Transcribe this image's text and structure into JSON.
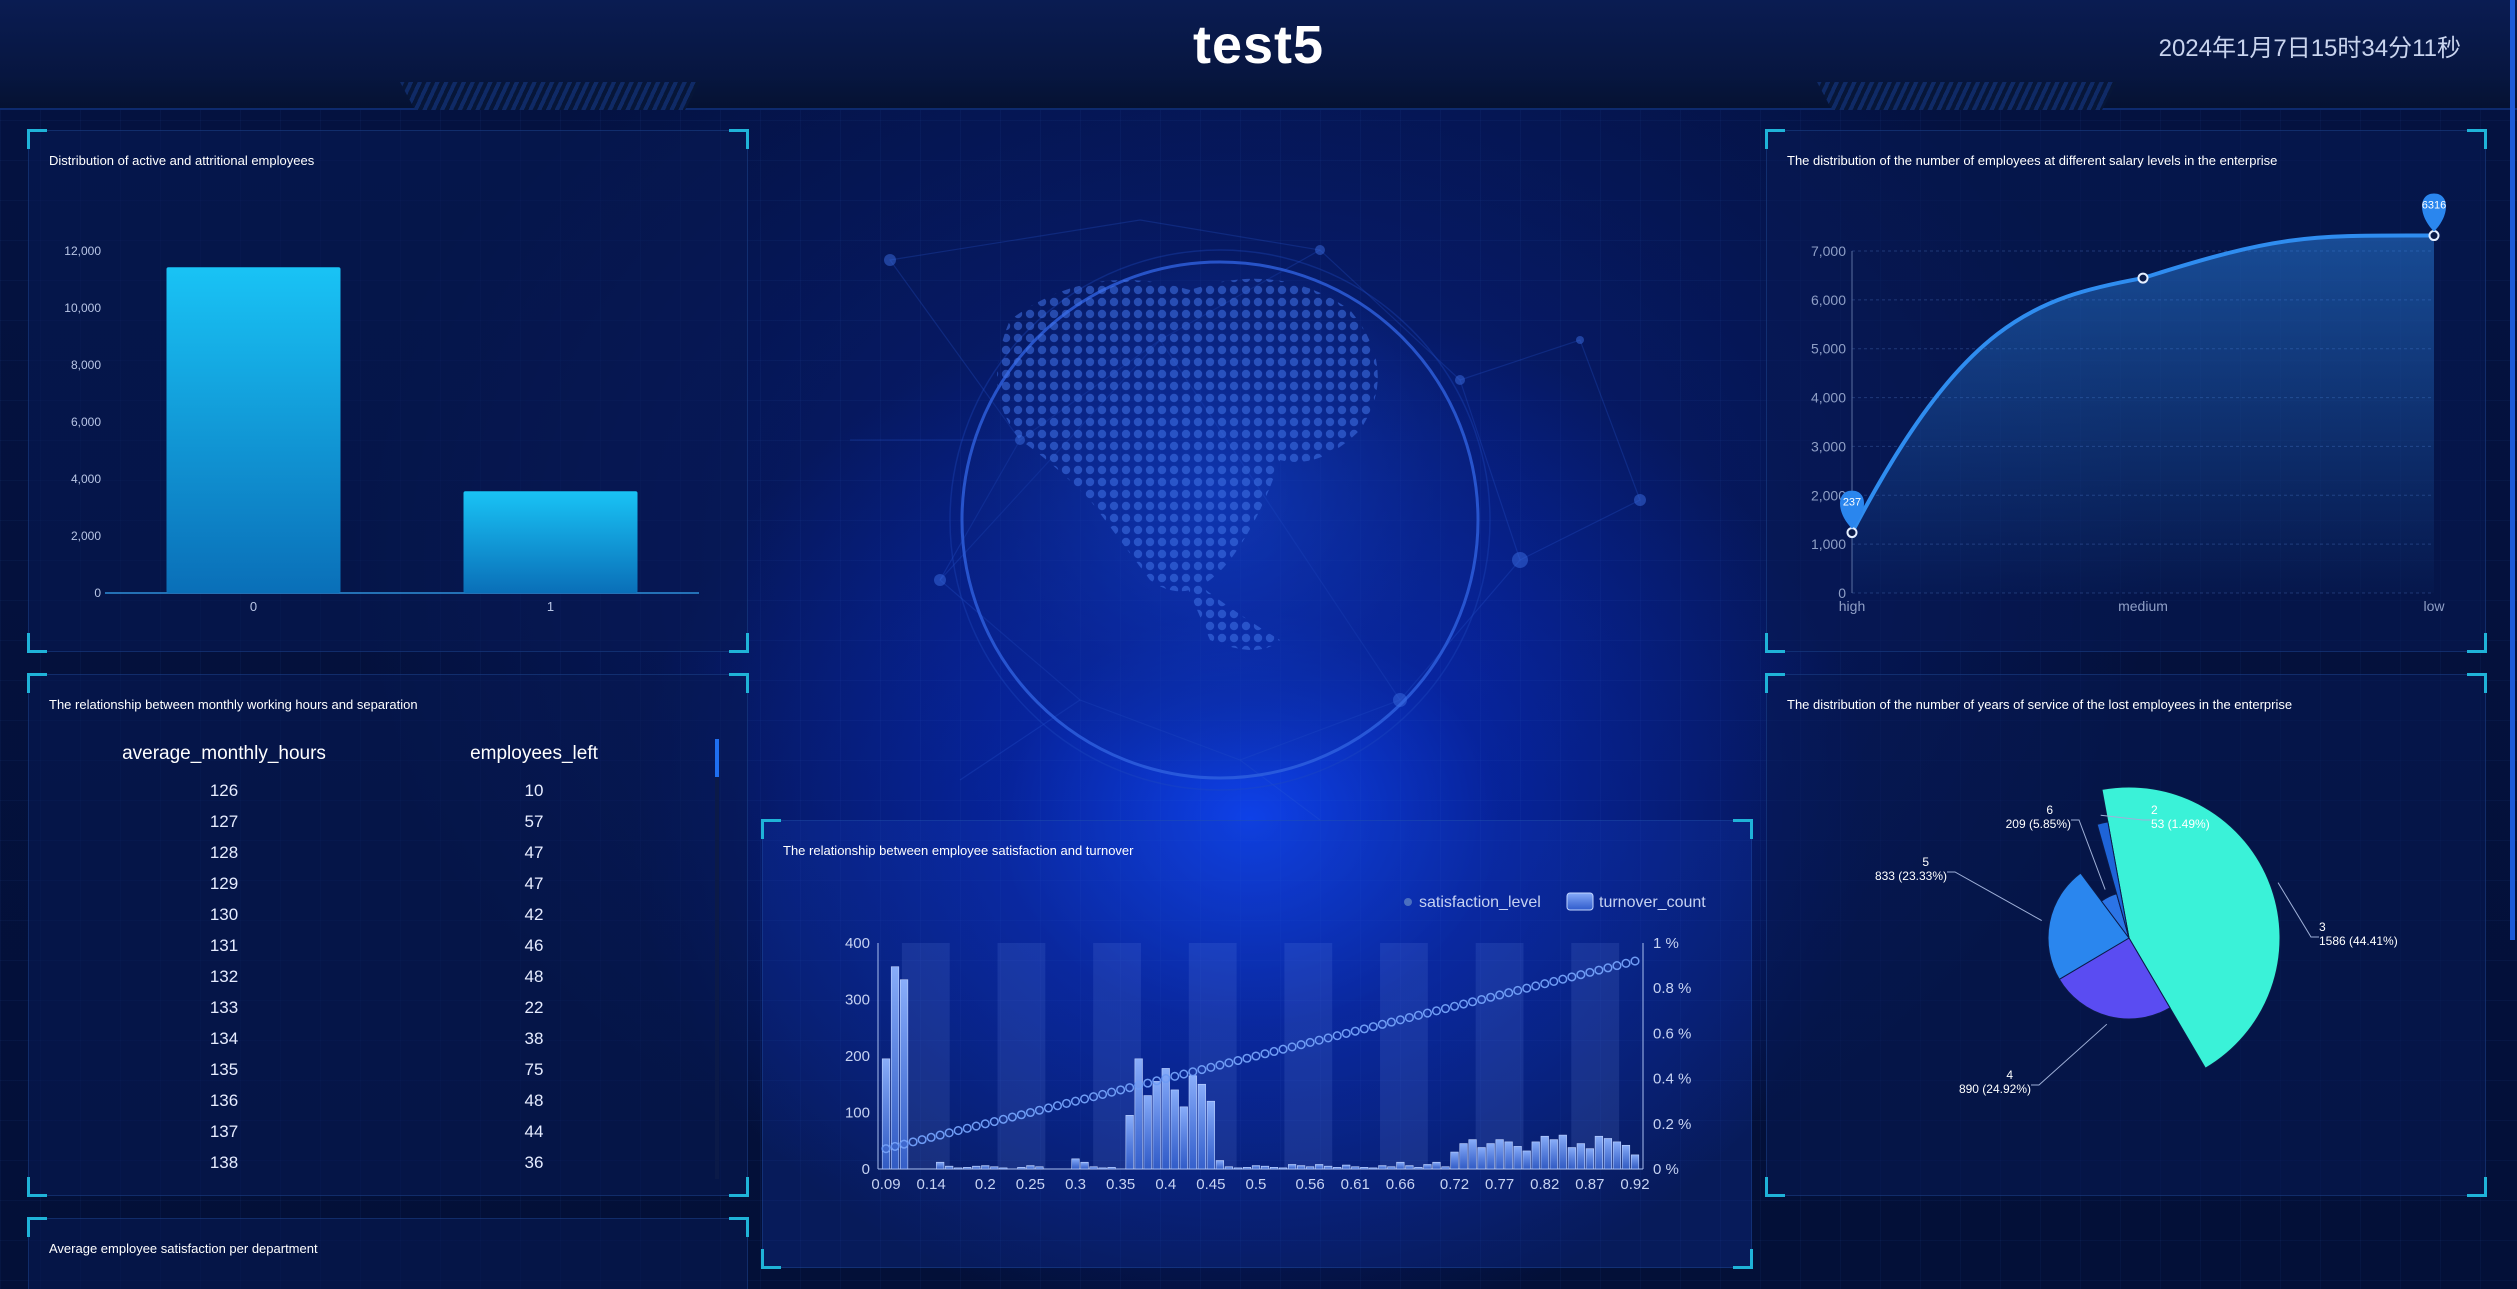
{
  "header": {
    "title": "test5",
    "datetime": "2024年1月7日15时34分11秒"
  },
  "panels": {
    "attrition": {
      "title": "Distribution of active and attritional employees"
    },
    "hours": {
      "title": "The relationship between monthly working hours and separation"
    },
    "dept": {
      "title": "Average employee satisfaction per department"
    },
    "satisfaction": {
      "title": "The relationship between employee satisfaction and turnover"
    },
    "salary": {
      "title": "The distribution of the number of employees at different salary levels in the enterprise"
    },
    "tenure": {
      "title": "The distribution of the number of years of service of the lost employees in the enterprise"
    }
  },
  "table": {
    "columns": [
      "average_monthly_hours",
      "employees_left"
    ],
    "rows": [
      [
        "126",
        "10"
      ],
      [
        "127",
        "57"
      ],
      [
        "128",
        "47"
      ],
      [
        "129",
        "47"
      ],
      [
        "130",
        "42"
      ],
      [
        "131",
        "46"
      ],
      [
        "132",
        "48"
      ],
      [
        "133",
        "22"
      ],
      [
        "134",
        "38"
      ],
      [
        "135",
        "75"
      ],
      [
        "136",
        "48"
      ],
      [
        "137",
        "44"
      ],
      [
        "138",
        "36"
      ]
    ]
  },
  "colors": {
    "accent": "#1fb3d8",
    "bar": "#19b6ee",
    "line": "#2f8df0",
    "pie": [
      "#3af2d8",
      "#5a4cf2",
      "#2a86ee",
      "#2b74e6",
      "#1e64d8"
    ]
  },
  "chart_data": [
    {
      "type": "bar",
      "categories": [
        "0",
        "1"
      ],
      "values": [
        11428,
        3571
      ],
      "ylim": [
        0,
        12000
      ],
      "yticks": [
        "0",
        "2,000",
        "4,000",
        "6,000",
        "8,000",
        "10,000",
        "12,000"
      ]
    },
    {
      "type": "area",
      "categories": [
        "high",
        "medium",
        "low"
      ],
      "values": [
        1237,
        6446,
        7316
      ],
      "markers": [
        "237",
        "6316"
      ],
      "ylim": [
        0,
        7000
      ],
      "yticks": [
        "0",
        "1,000",
        "2,000",
        "3,000",
        "4,000",
        "5,000",
        "6,000",
        "7,000"
      ]
    },
    {
      "type": "pie",
      "slices": [
        {
          "label": "3",
          "value": 1586,
          "text": "1586 (44.41%)"
        },
        {
          "label": "4",
          "value": 890,
          "text": "890 (24.92%)"
        },
        {
          "label": "5",
          "value": 833,
          "text": "833 (23.33%)"
        },
        {
          "label": "6",
          "value": 209,
          "text": "209 (5.85%)"
        },
        {
          "label": "2",
          "value": 53,
          "text": "53 (1.49%)"
        }
      ]
    },
    {
      "type": "bar",
      "legend": [
        "satisfaction_level",
        "turnover_count"
      ],
      "xticks": [
        "0.09",
        "0.14",
        "0.2",
        "0.25",
        "0.3",
        "0.35",
        "0.4",
        "0.45",
        "0.5",
        "0.56",
        "0.61",
        "0.66",
        "0.72",
        "0.77",
        "0.82",
        "0.87",
        "0.92"
      ],
      "yticks_left": [
        "0",
        "100",
        "200",
        "300",
        "400"
      ],
      "yticks_right": [
        "0 %",
        "0.2 %",
        "0.4 %",
        "0.6 %",
        "0.8 %",
        "1 %"
      ],
      "ylim": [
        0,
        400
      ],
      "y2lim": [
        0,
        1
      ],
      "x": [
        0.09,
        0.1,
        0.11,
        0.12,
        0.13,
        0.14,
        0.15,
        0.16,
        0.17,
        0.18,
        0.19,
        0.2,
        0.21,
        0.22,
        0.23,
        0.24,
        0.25,
        0.26,
        0.27,
        0.28,
        0.29,
        0.3,
        0.31,
        0.32,
        0.33,
        0.34,
        0.35,
        0.36,
        0.37,
        0.38,
        0.39,
        0.4,
        0.41,
        0.42,
        0.43,
        0.44,
        0.45,
        0.46,
        0.47,
        0.48,
        0.49,
        0.5,
        0.51,
        0.52,
        0.53,
        0.54,
        0.55,
        0.56,
        0.57,
        0.58,
        0.59,
        0.6,
        0.61,
        0.62,
        0.63,
        0.64,
        0.65,
        0.66,
        0.67,
        0.68,
        0.69,
        0.7,
        0.71,
        0.72,
        0.73,
        0.74,
        0.75,
        0.76,
        0.77,
        0.78,
        0.79,
        0.8,
        0.81,
        0.82,
        0.83,
        0.84,
        0.85,
        0.86,
        0.87,
        0.88,
        0.89,
        0.9,
        0.91,
        0.92
      ],
      "values": [
        195,
        358,
        335,
        0,
        0,
        0,
        12,
        5,
        2,
        3,
        5,
        6,
        4,
        2,
        0,
        3,
        6,
        4,
        0,
        0,
        0,
        18,
        12,
        4,
        2,
        3,
        0,
        95,
        195,
        130,
        155,
        178,
        140,
        110,
        165,
        150,
        120,
        15,
        4,
        2,
        3,
        6,
        5,
        3,
        2,
        8,
        6,
        4,
        8,
        5,
        3,
        7,
        4,
        3,
        2,
        6,
        4,
        12,
        6,
        3,
        8,
        12,
        4,
        30,
        45,
        52,
        38,
        45,
        52,
        48,
        40,
        32,
        48,
        58,
        52,
        60,
        38,
        45,
        36,
        58,
        54,
        48,
        42,
        25
      ],
      "line_values": [
        0.09,
        0.1,
        0.11,
        0.12,
        0.13,
        0.14,
        0.15,
        0.16,
        0.17,
        0.18,
        0.19,
        0.2,
        0.21,
        0.22,
        0.23,
        0.24,
        0.25,
        0.26,
        0.27,
        0.28,
        0.29,
        0.3,
        0.31,
        0.32,
        0.33,
        0.34,
        0.35,
        0.36,
        0.37,
        0.38,
        0.39,
        0.4,
        0.41,
        0.42,
        0.43,
        0.44,
        0.45,
        0.46,
        0.47,
        0.48,
        0.49,
        0.5,
        0.51,
        0.52,
        0.53,
        0.54,
        0.55,
        0.56,
        0.57,
        0.58,
        0.59,
        0.6,
        0.61,
        0.62,
        0.63,
        0.64,
        0.65,
        0.66,
        0.67,
        0.68,
        0.69,
        0.7,
        0.71,
        0.72,
        0.73,
        0.74,
        0.75,
        0.76,
        0.77,
        0.78,
        0.79,
        0.8,
        0.81,
        0.82,
        0.83,
        0.84,
        0.85,
        0.86,
        0.87,
        0.88,
        0.89,
        0.9,
        0.91,
        0.92
      ]
    }
  ]
}
